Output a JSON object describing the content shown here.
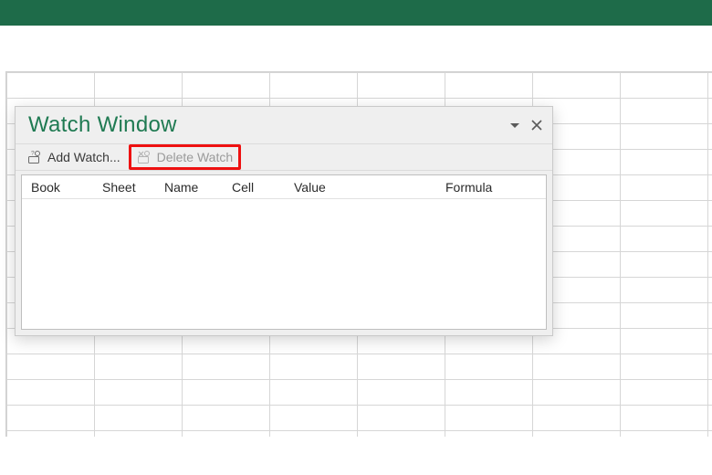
{
  "colors": {
    "accent": "#1f7a52",
    "titlebar": "#1e6b49",
    "highlight": "#e11"
  },
  "watch_window": {
    "title": "Watch Window",
    "toolbar": {
      "add_watch_label": "Add Watch...",
      "delete_watch_label": "Delete Watch",
      "delete_watch_highlighted": true,
      "delete_watch_enabled": false
    },
    "columns": {
      "book": "Book",
      "sheet": "Sheet",
      "name": "Name",
      "cell": "Cell",
      "value": "Value",
      "formula": "Formula"
    },
    "rows": []
  }
}
